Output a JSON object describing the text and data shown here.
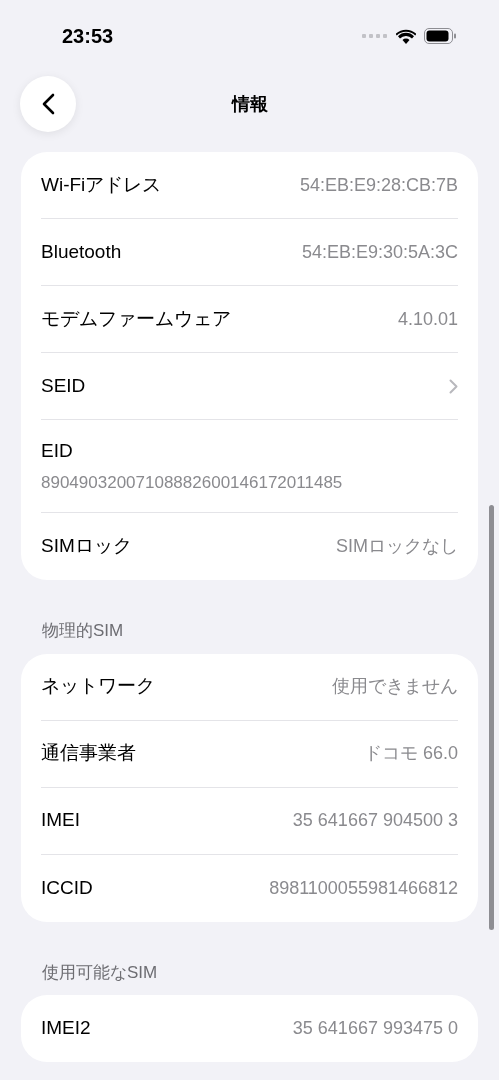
{
  "status_bar": {
    "time": "23:53"
  },
  "nav": {
    "title": "情報"
  },
  "sections": [
    {
      "rows": [
        {
          "kind": "value",
          "label": "Wi-Fiアドレス",
          "value": "54:EB:E9:28:CB:7B"
        },
        {
          "kind": "value",
          "label": "Bluetooth",
          "value": "54:EB:E9:30:5A:3C"
        },
        {
          "kind": "value",
          "label": "モデムファームウェア",
          "value": "4.10.01"
        },
        {
          "kind": "link",
          "label": "SEID"
        },
        {
          "kind": "stacked",
          "label": "EID",
          "value": "89049032007108882600146172011485"
        },
        {
          "kind": "value",
          "label": "SIMロック",
          "value": "SIMロックなし"
        }
      ]
    },
    {
      "header": "物理的SIM",
      "rows": [
        {
          "kind": "value",
          "label": "ネットワーク",
          "value": "使用できません"
        },
        {
          "kind": "value",
          "label": "通信事業者",
          "value": "ドコモ 66.0"
        },
        {
          "kind": "value",
          "label": "IMEI",
          "value": "35 641667 904500 3"
        },
        {
          "kind": "value",
          "label": "ICCID",
          "value": "8981100055981466812"
        }
      ]
    },
    {
      "header": "使用可能なSIM",
      "rows": [
        {
          "kind": "value",
          "label": "IMEI2",
          "value": "35 641667 993475 0"
        }
      ]
    }
  ]
}
